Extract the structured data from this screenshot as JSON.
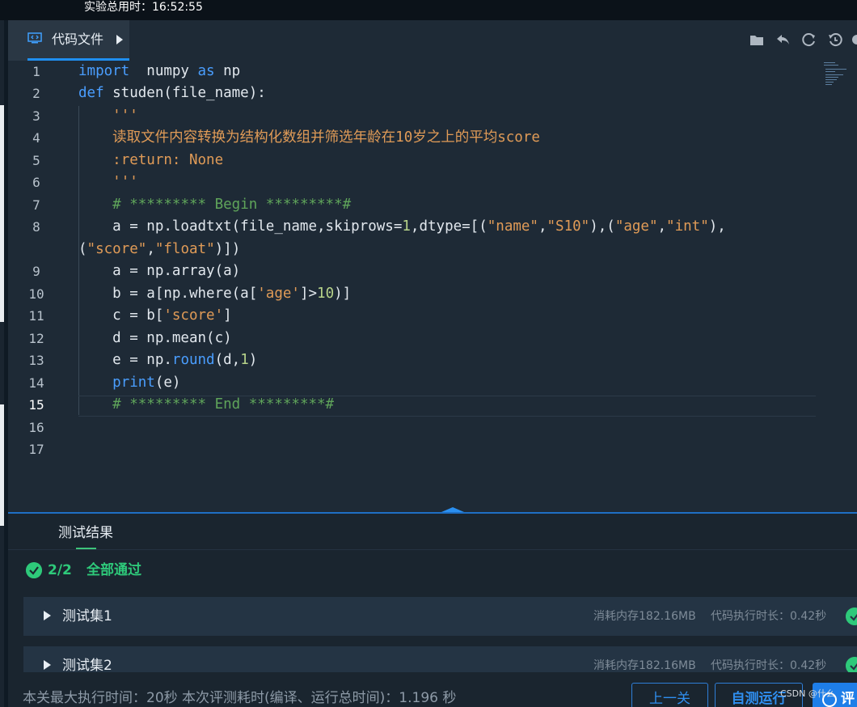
{
  "topbar": {
    "timer": "实验总用时：16:52:55"
  },
  "editor": {
    "tab_label": "代码文件",
    "tab_icon": "code-file-icon",
    "toolbar_icons": [
      "folder-icon",
      "undo-icon",
      "refresh-icon",
      "history-icon",
      "settings-icon"
    ],
    "line_numbers": [
      "1",
      "2",
      "3",
      "4",
      "5",
      "6",
      "7",
      "8",
      "",
      "9",
      "10",
      "11",
      "12",
      "13",
      "14",
      "15",
      "16",
      "17"
    ],
    "current_line": "15"
  },
  "results": {
    "tab_label": "测试结果",
    "score": "2/2",
    "status": "全部通过",
    "cases": [
      {
        "name": "测试集1",
        "memory": "消耗内存182.16MB",
        "time": "代码执行时长：0.42秒"
      },
      {
        "name": "测试集2",
        "memory": "消耗内存182.16MB",
        "time": "代码执行时长：0.42秒"
      }
    ]
  },
  "bottombar": {
    "info": "本关最大执行时间：20秒    本次评测耗时(编译、运行总时间)：1.196 秒",
    "prev_label": "上一关",
    "run_label": "自测运行",
    "eval_label": "评"
  },
  "watermark": "CSDN @什么",
  "colors": {
    "accent": "#1f8ff0",
    "success": "#2ec97a",
    "editor_bg": "#1e2a36",
    "keyword": "#4a9eff",
    "string": "#e09b57",
    "comment": "#5fa45a"
  }
}
